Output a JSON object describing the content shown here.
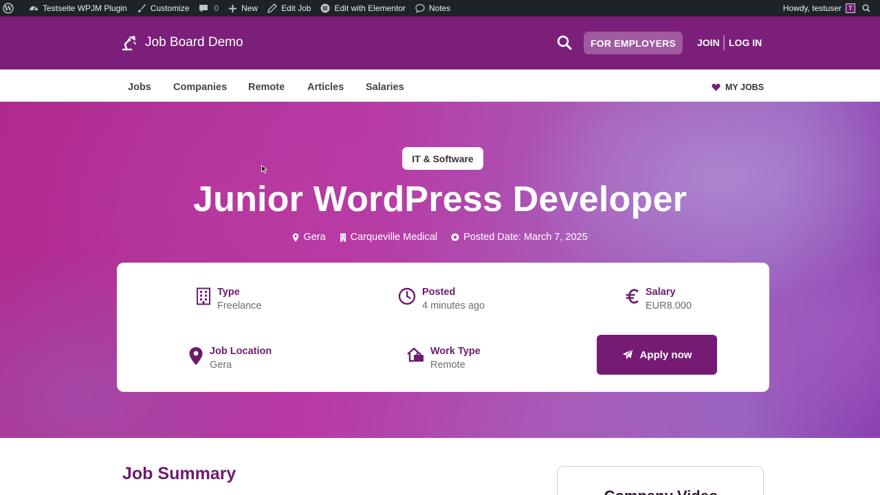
{
  "adminbar": {
    "site": "Testseite WPJM Plugin",
    "customize": "Customize",
    "comments_count": "0",
    "new": "New",
    "edit_job": "Edit Job",
    "edit_elementor": "Edit with Elementor",
    "notes": "Notes",
    "greeting": "Howdy, testuser"
  },
  "header": {
    "brand": "Job Board Demo",
    "employers": "FOR EMPLOYERS",
    "join": "JOIN",
    "login": "LOG IN"
  },
  "nav": {
    "items": [
      "Jobs",
      "Companies",
      "Remote",
      "Articles",
      "Salaries"
    ],
    "my_jobs": "MY JOBS"
  },
  "hero": {
    "category": "IT & Software",
    "title": "Junior WordPress Developer",
    "location": "Gera",
    "company": "Carqueville Medical",
    "posted_date": "Posted Date: March 7, 2025"
  },
  "details": {
    "type_label": "Type",
    "type_value": "Freelance",
    "posted_label": "Posted",
    "posted_value": "4 minutes ago",
    "salary_label": "Salary",
    "salary_value": "EUR8.000",
    "location_label": "Job Location",
    "location_value": "Gera",
    "worktype_label": "Work Type",
    "worktype_value": "Remote",
    "apply": "Apply now"
  },
  "content": {
    "summary_title": "Job Summary",
    "video_title": "Company Video"
  },
  "colors": {
    "brand": "#7b1f7a",
    "accent_button": "#751b74",
    "admin_bar": "#1d2327"
  },
  "icons": {
    "wordpress": "wordpress-icon",
    "customize": "brush-icon",
    "comment": "comment-icon",
    "new": "plus-icon",
    "edit": "pencil-icon",
    "elementor": "elementor-icon",
    "notes": "speech-bubble-icon",
    "search": "search-icon",
    "logo": "desk-lamp-icon",
    "heart": "heart-icon",
    "building": "building-icon",
    "clock": "clock-icon",
    "euro": "euro-icon",
    "pin": "map-pin-icon",
    "home": "home-work-icon",
    "send": "paper-plane-icon"
  }
}
